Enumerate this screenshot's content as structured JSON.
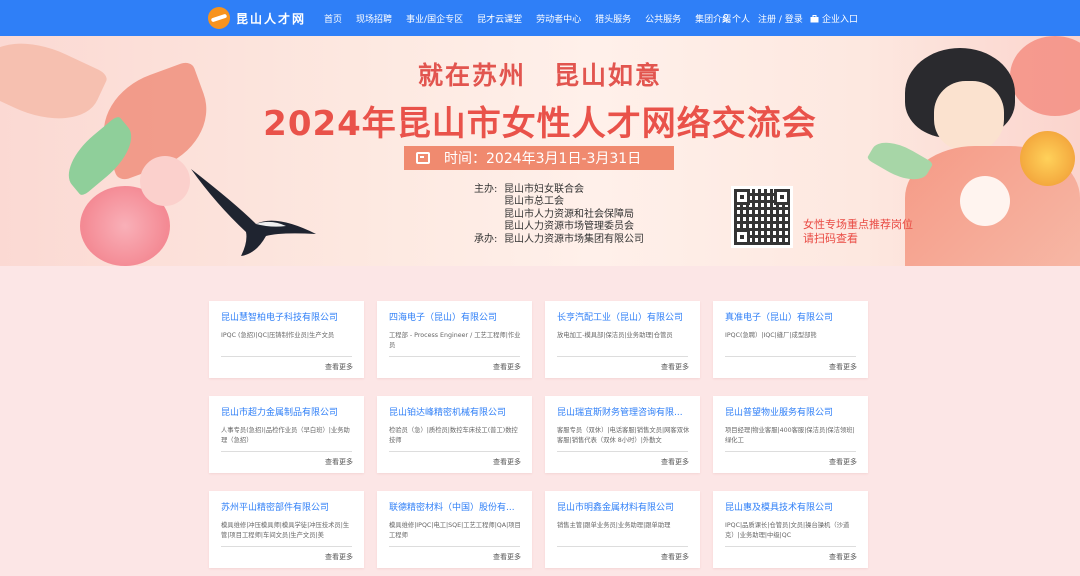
{
  "header": {
    "logo_text": "昆山人才网",
    "nav": [
      "首页",
      "现场招聘",
      "事业/国企专区",
      "昆才云课堂",
      "劳动者中心",
      "猎头服务",
      "公共服务",
      "集团介绍"
    ],
    "personal": "个人",
    "login": "注册 / 登录",
    "enterprise": "企业入口"
  },
  "banner": {
    "slogan_left": "就在苏州",
    "slogan_right": "昆山如意",
    "headline": "2024年昆山市女性人才网络交流会",
    "time_label": "时间：2024年3月1日-3月31日",
    "host_label": "主办:",
    "hosts": [
      "昆山市妇女联合会",
      "昆山市总工会",
      "昆山市人力资源和社会保障局",
      "昆山人力资源市场管理委员会"
    ],
    "organizer_label": "承办:",
    "organizer": "昆山人力资源市场集团有限公司",
    "qr_note_line1": "女性专场重点推荐岗位",
    "qr_note_line2": "请扫码查看"
  },
  "cards": [
    {
      "title": "昆山慧智柏电子科技有限公司",
      "desc": "IPQC (急招)|QC|压铸制作业员|生产文员",
      "more": "查看更多"
    },
    {
      "title": "四海电子（昆山）有限公司",
      "desc": "工程部 - Process Engineer / 工艺工程师|作业员",
      "more": "查看更多"
    },
    {
      "title": "长亨汽配工业（昆山）有限公司",
      "desc": "放电加工-模具部|保洁员|业务助理|仓管员",
      "more": "查看更多"
    },
    {
      "title": "真准电子（昆山）有限公司",
      "desc": "IPQC(急聘）|IQC|缝厂|成型部熊",
      "more": "查看更多"
    },
    {
      "title": "昆山市超力金属制品有限公司",
      "desc": "人事专员(急招)|品检作业员（早白班）|业务助理（急招）",
      "more": "查看更多"
    },
    {
      "title": "昆山铂达峰精密机械有限公司",
      "desc": "检验员（急）|质检员|数控车床技工(普工)数控技师",
      "more": "查看更多"
    },
    {
      "title": "昆山瑞宜斯财务管理咨询有限...",
      "desc": "客服专员（双休）|电话客服|销售文员|网客双休客服|销售代表（双休 8小时）|外勤文",
      "more": "查看更多"
    },
    {
      "title": "昆山普望物业服务有限公司",
      "desc": "项目经理|物业客服|400客服|保洁员|保洁领班|绿化工",
      "more": "查看更多"
    },
    {
      "title": "苏州平山精密部件有限公司",
      "desc": "模具维修|冲压模具师|模具学徒|冲压技术员|生管|项目工程师|车间文员|生产文员|美",
      "more": "查看更多"
    },
    {
      "title": "联德精密材料（中国）股份有...",
      "desc": "模具维修|IPQC|电工|SQE|工艺工程师|QA|项目工程师",
      "more": "查看更多"
    },
    {
      "title": "昆山市明鑫金属材料有限公司",
      "desc": "销售主管|跟单业务员|业务助理|跟单助理",
      "more": "查看更多"
    },
    {
      "title": "昆山惠及模具技术有限公司",
      "desc": "IPQC|品质课长|仓管员|文员|操台操机（沙道克）|业务助理|中级|QC",
      "more": "查看更多"
    }
  ]
}
